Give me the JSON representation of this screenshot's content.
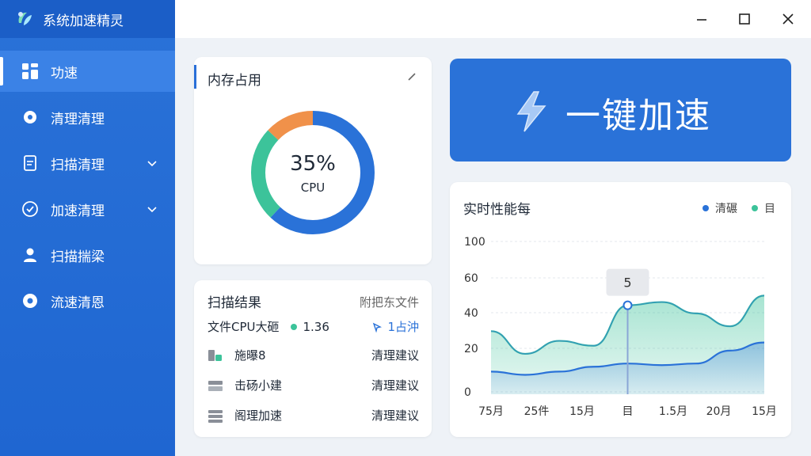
{
  "app": {
    "title": "系统加速精灵"
  },
  "sidebar": {
    "items": [
      {
        "label": "功速",
        "active": true,
        "icon": "grid-icon",
        "has_chevron": false
      },
      {
        "label": "清理清理",
        "active": false,
        "icon": "gear-icon",
        "has_chevron": false
      },
      {
        "label": "扫描清理",
        "active": false,
        "icon": "document-icon",
        "has_chevron": true
      },
      {
        "label": "加速清理",
        "active": false,
        "icon": "check-circle-icon",
        "has_chevron": true
      },
      {
        "label": "扫描揣梁",
        "active": false,
        "icon": "user-icon",
        "has_chevron": false
      },
      {
        "label": "流速清恩",
        "active": false,
        "icon": "settings-icon",
        "has_chevron": false
      }
    ]
  },
  "memory": {
    "title": "内存占用",
    "percent_label": "35%",
    "sub_label": "CPU",
    "segments": [
      {
        "name": "blue",
        "fraction": 0.62,
        "color": "#2a72d8"
      },
      {
        "name": "green",
        "fraction": 0.25,
        "color": "#3cc39a"
      },
      {
        "name": "orange",
        "fraction": 0.13,
        "color": "#f0914a"
      }
    ]
  },
  "scan": {
    "title": "扫描结果",
    "link": "附把东文件",
    "summary_label": "文件CPU大砸",
    "summary_value": "1.36",
    "summary_right": "1占沖",
    "rows": [
      {
        "label": "施曝8",
        "action": "清理建议",
        "icon": "lock-file-icon"
      },
      {
        "label": "击砀小建",
        "action": "清理建议",
        "icon": "stack-icon"
      },
      {
        "label": "阁理加速",
        "action": "清理建议",
        "icon": "list-icon"
      }
    ]
  },
  "boost": {
    "label": "一键加速",
    "icon": "lightning-icon"
  },
  "chart_data": {
    "type": "area",
    "title": "实时性能每",
    "legend": [
      {
        "name": "清碾",
        "color": "#2a72d8"
      },
      {
        "name": "目",
        "color": "#3cc39a"
      }
    ],
    "y_ticks": [
      "100",
      "60",
      "40",
      "20",
      "0"
    ],
    "x_ticks": [
      "75月",
      "25件",
      "15月",
      "目",
      "1.5月",
      "20月",
      "15月"
    ],
    "tooltip_value": "5",
    "series": [
      {
        "name": "清碾",
        "values": [
          14,
          12,
          14,
          17,
          19,
          18,
          19,
          27,
          32
        ]
      },
      {
        "name": "目",
        "values": [
          39,
          25,
          33,
          30,
          55,
          57,
          50,
          42,
          61
        ]
      }
    ],
    "marker_index": 4
  },
  "colors": {
    "accent": "#2a72d8",
    "green": "#3cc39a",
    "orange": "#f0914a"
  }
}
